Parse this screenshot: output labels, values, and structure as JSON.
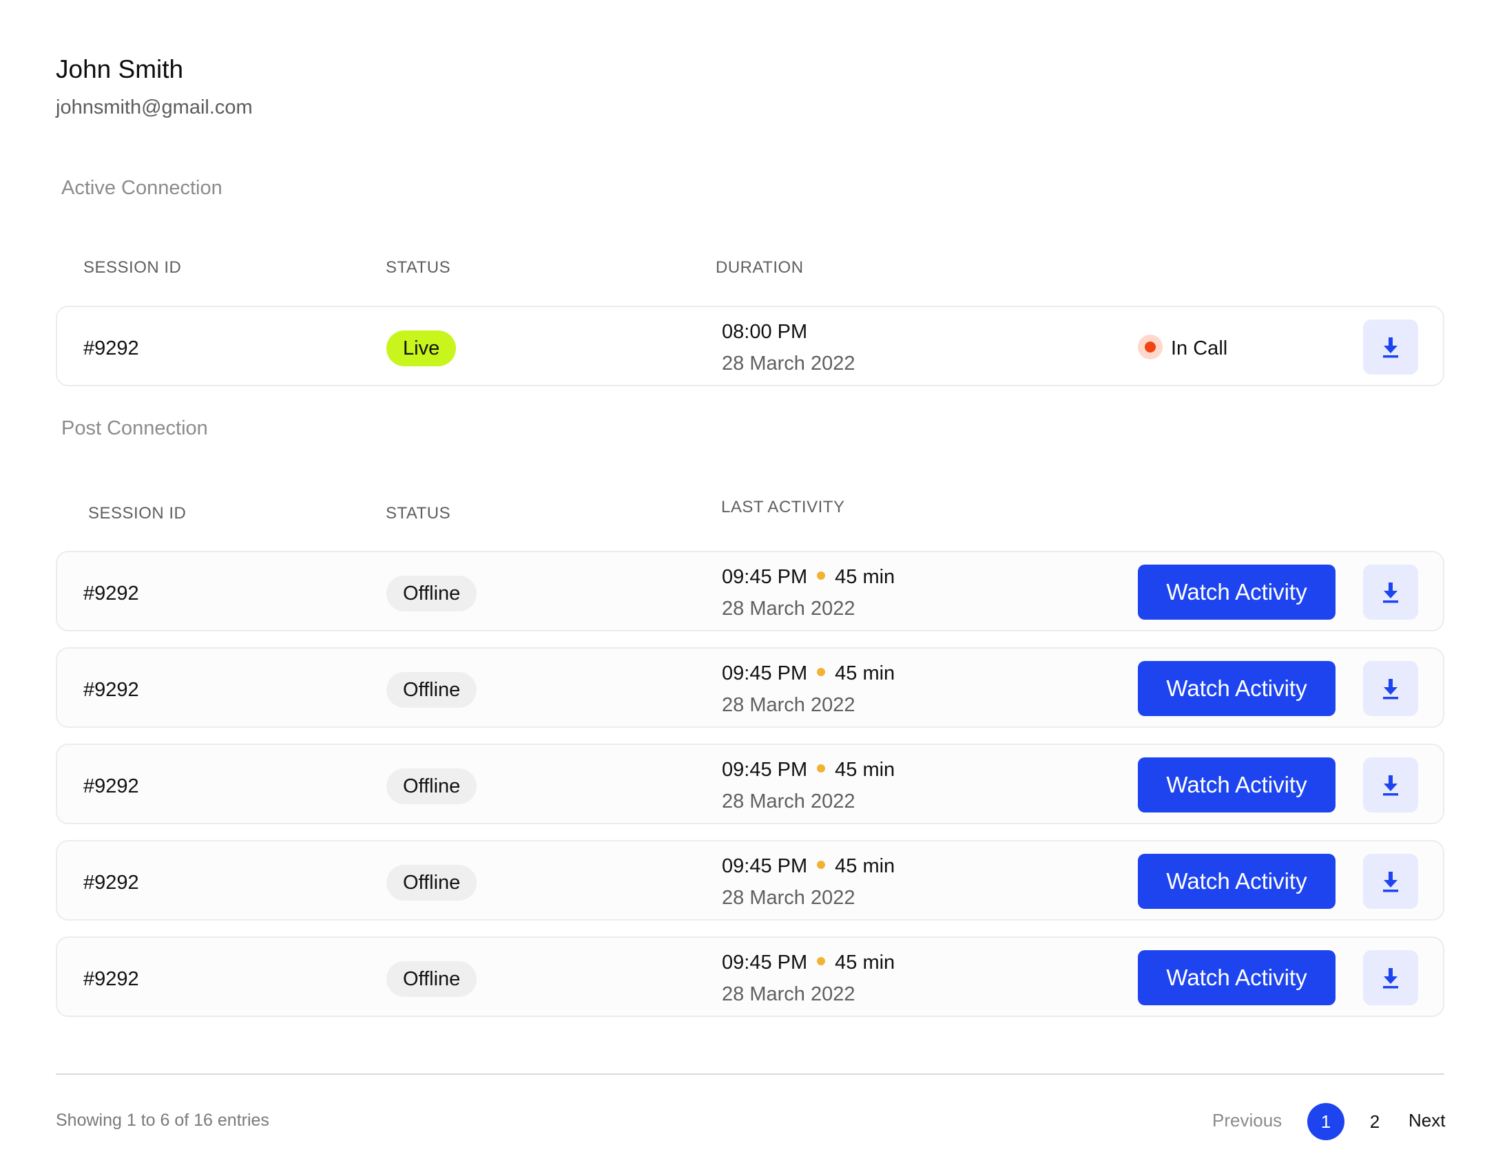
{
  "user": {
    "name": "John Smith",
    "email": "johnsmith@gmail.com"
  },
  "active": {
    "title": "Active Connection",
    "headers": {
      "session": "SESSION ID",
      "status": "STATUS",
      "duration": "DURATION"
    },
    "row": {
      "session_id": "#9292",
      "status": "Live",
      "time": "08:00 PM",
      "date": "28 March 2022",
      "call_state": "In Call",
      "download_icon": "download-icon"
    }
  },
  "post": {
    "title": "Post Connection",
    "headers": {
      "session": "SESSION ID",
      "status": "STATUS",
      "last_activity": "LAST ACTIVITY"
    },
    "rows": [
      {
        "session_id": "#9292",
        "status": "Offline",
        "time": "09:45 PM",
        "length": "45 min",
        "date": "28 March 2022",
        "action": "Watch Activity"
      },
      {
        "session_id": "#9292",
        "status": "Offline",
        "time": "09:45 PM",
        "length": "45 min",
        "date": "28 March 2022",
        "action": "Watch Activity"
      },
      {
        "session_id": "#9292",
        "status": "Offline",
        "time": "09:45 PM",
        "length": "45 min",
        "date": "28 March 2022",
        "action": "Watch Activity"
      },
      {
        "session_id": "#9292",
        "status": "Offline",
        "time": "09:45 PM",
        "length": "45 min",
        "date": "28 March 2022",
        "action": "Watch Activity"
      },
      {
        "session_id": "#9292",
        "status": "Offline",
        "time": "09:45 PM",
        "length": "45 min",
        "date": "28 March 2022",
        "action": "Watch Activity"
      }
    ]
  },
  "pagination": {
    "summary": "Showing 1 to 6 of 16 entries",
    "previous": "Previous",
    "pages": [
      "1",
      "2"
    ],
    "current_page": "1",
    "next": "Next"
  },
  "colors": {
    "accent": "#1d44ef",
    "live": "#c8f51c",
    "offline": "#efefef",
    "in_call_dot": "#f24413",
    "duration_dot": "#f2b233",
    "download_bg": "#e7ebfd"
  }
}
